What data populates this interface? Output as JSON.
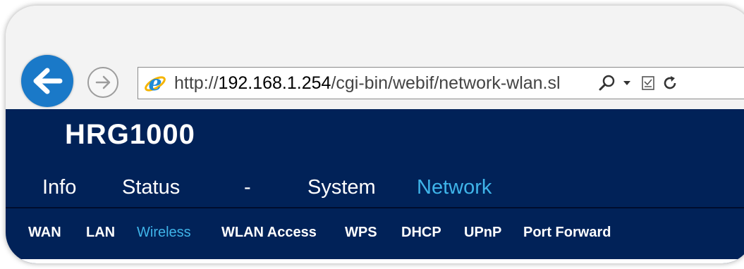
{
  "browser": {
    "url_prefix": "http://",
    "url_host": "192.168.1.254",
    "url_path": "/cgi-bin/webif/network-wlan.sl",
    "icons": {
      "back": "back-arrow-icon",
      "forward": "forward-arrow-icon",
      "page": "ie-logo-icon",
      "search": "search-icon",
      "dropdown": "chevron-down-icon",
      "compat": "compatibility-view-icon",
      "refresh": "refresh-icon"
    },
    "colors": {
      "back_button": "#1a79c8"
    }
  },
  "router": {
    "brand": "HRG1000",
    "main_nav": [
      {
        "label": "Info",
        "active": false
      },
      {
        "label": "Status",
        "active": false
      },
      {
        "label": "-",
        "active": false
      },
      {
        "label": "System",
        "active": false
      },
      {
        "label": "Network",
        "active": true
      }
    ],
    "sub_nav": [
      {
        "label": "WAN",
        "active": false
      },
      {
        "label": "LAN",
        "active": false
      },
      {
        "label": "Wireless",
        "active": true
      },
      {
        "label": "WLAN Access",
        "active": false
      },
      {
        "label": "WPS",
        "active": false
      },
      {
        "label": "DHCP",
        "active": false
      },
      {
        "label": "UPnP",
        "active": false
      },
      {
        "label": "Port Forward",
        "active": false
      }
    ],
    "colors": {
      "background": "#012258",
      "active": "#3fb4e9",
      "text": "#ffffff"
    }
  }
}
